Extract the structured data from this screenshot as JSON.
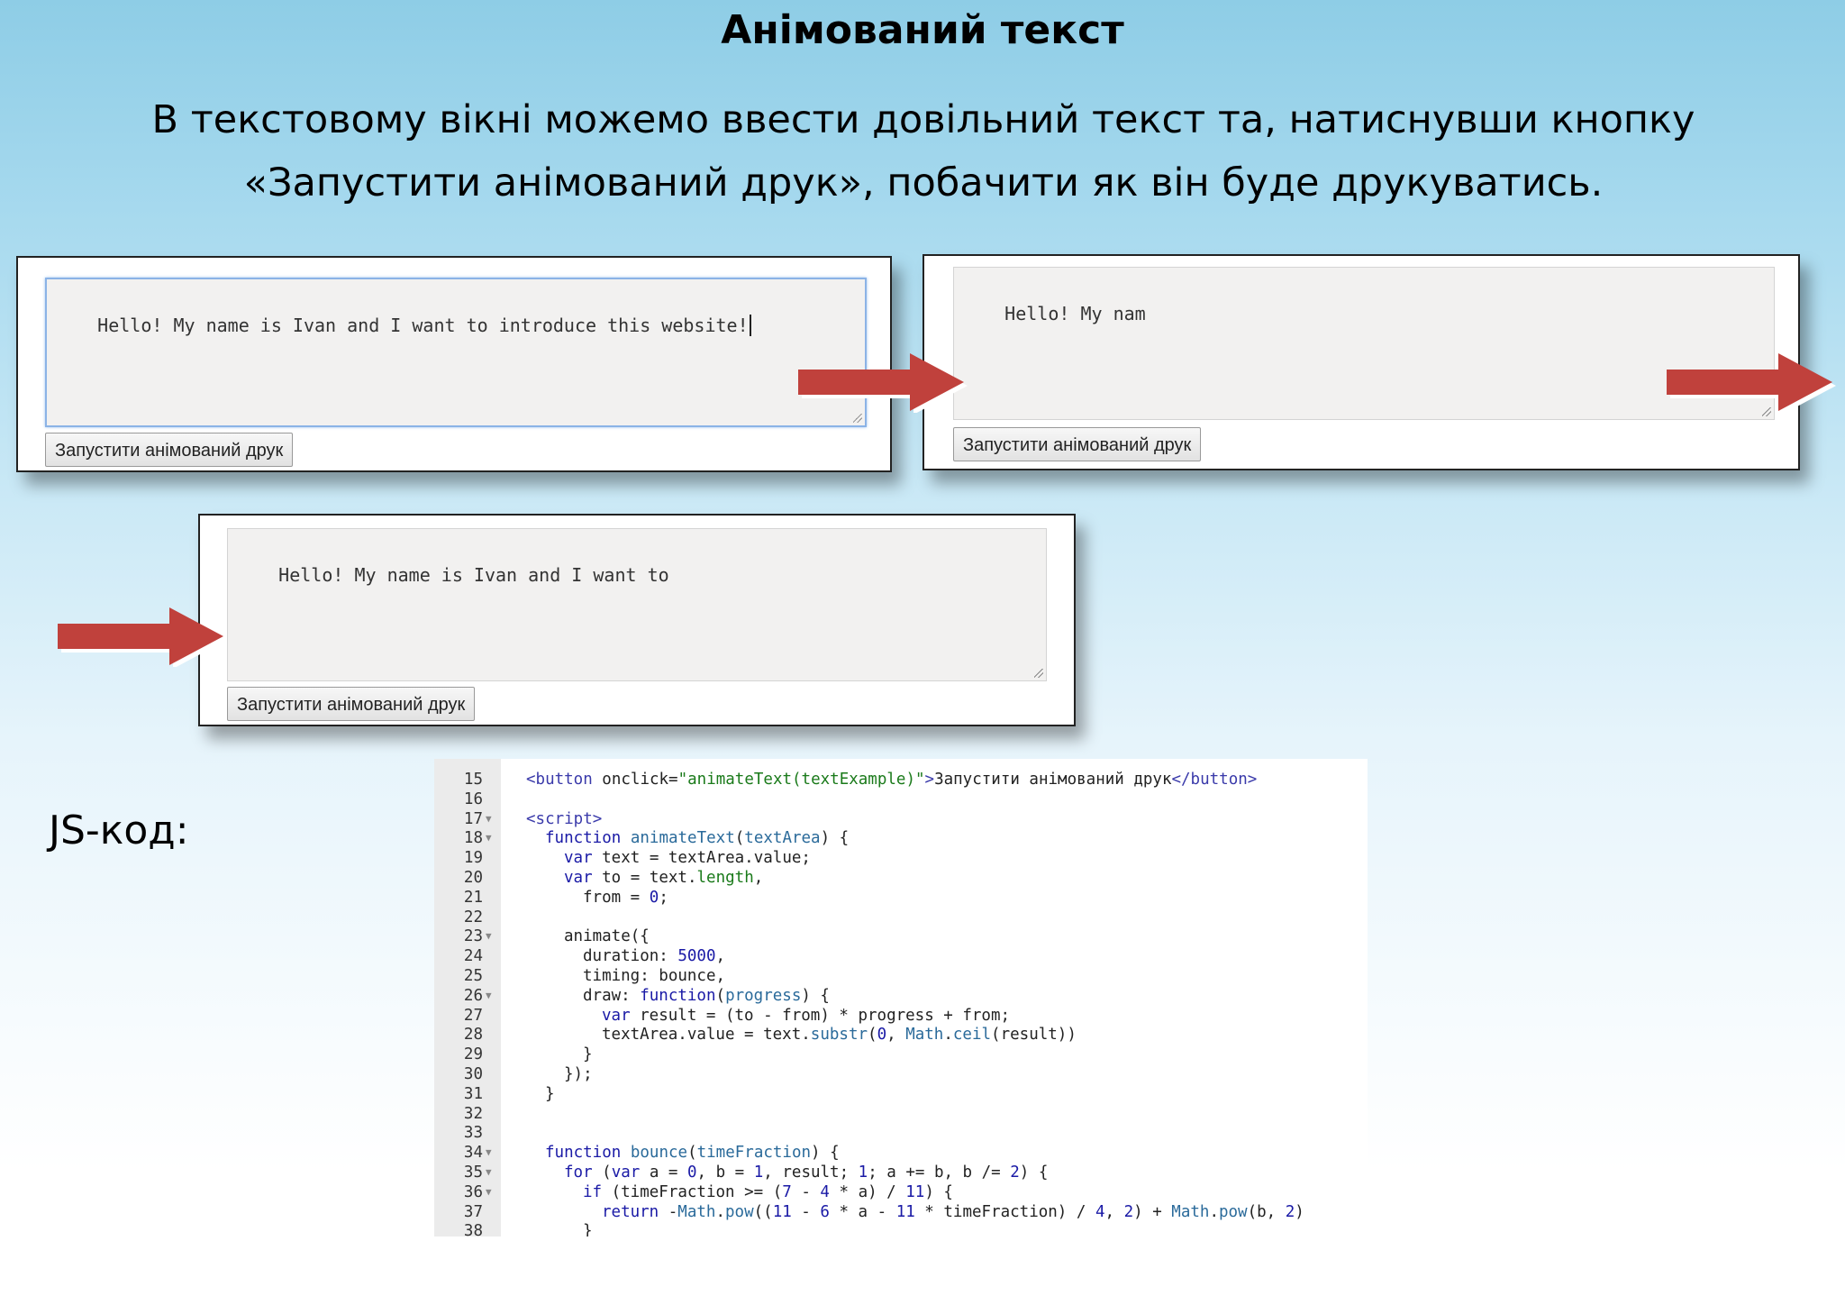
{
  "slide": {
    "title": "Анімований текст",
    "description": "В текстовому вікні можемо ввести довільний текст та, натиснувши кнопку «Запустити анімований друк», побачити як він буде друкуватись."
  },
  "windows": [
    {
      "text": "Hello! My name is Ivan and I want to introduce this website!",
      "button": "Запустити анімований друк"
    },
    {
      "text": "Hello! My nam",
      "button": "Запустити анімований друк"
    },
    {
      "text": "Hello! My name is Ivan and I want to",
      "button": "Запустити анімований друк"
    }
  ],
  "colors": {
    "arrow": "#c0413c",
    "focus": "#8bb3e6"
  },
  "js_label": "JS-код:",
  "code_lines": [
    {
      "n": "15",
      "fold": false,
      "indent": 0,
      "html": "<span class='tag'>&lt;button</span> onclick=<span class='str'>\"animateText(textExample)\"</span><span class='tag'>&gt;</span>Запустити анімований друк<span class='tag'>&lt;/button&gt;</span>"
    },
    {
      "n": "16",
      "fold": false,
      "indent": 0,
      "html": ""
    },
    {
      "n": "17",
      "fold": true,
      "indent": 0,
      "html": "<span class='tag'>&lt;script&gt;</span>"
    },
    {
      "n": "18",
      "fold": true,
      "indent": 1,
      "html": "<span class='kw'>function</span> <span class='var'>animateText</span>(<span class='var'>textArea</span>) {"
    },
    {
      "n": "19",
      "fold": false,
      "indent": 2,
      "html": "<span class='kw'>var</span> text = textArea.value;"
    },
    {
      "n": "20",
      "fold": false,
      "indent": 2,
      "html": "<span class='kw'>var</span> to = text.<span class='str'>length</span>,"
    },
    {
      "n": "21",
      "fold": false,
      "indent": 3,
      "html": "from = <span class='num'>0</span>;"
    },
    {
      "n": "22",
      "fold": false,
      "indent": 0,
      "html": ""
    },
    {
      "n": "23",
      "fold": true,
      "indent": 2,
      "html": "animate({"
    },
    {
      "n": "24",
      "fold": false,
      "indent": 3,
      "html": "duration: <span class='num'>5000</span>,"
    },
    {
      "n": "25",
      "fold": false,
      "indent": 3,
      "html": "timing: bounce,"
    },
    {
      "n": "26",
      "fold": true,
      "indent": 3,
      "html": "draw: <span class='kw'>function</span>(<span class='var'>progress</span>) {"
    },
    {
      "n": "27",
      "fold": false,
      "indent": 4,
      "html": "<span class='kw'>var</span> result = (to - from) * progress + from;"
    },
    {
      "n": "28",
      "fold": false,
      "indent": 4,
      "html": "textArea.value = text.<span class='var'>substr</span>(<span class='num'>0</span>, <span class='var'>Math</span>.<span class='var'>ceil</span>(result))"
    },
    {
      "n": "29",
      "fold": false,
      "indent": 3,
      "html": "}"
    },
    {
      "n": "30",
      "fold": false,
      "indent": 2,
      "html": "});"
    },
    {
      "n": "31",
      "fold": false,
      "indent": 1,
      "html": "}"
    },
    {
      "n": "32",
      "fold": false,
      "indent": 0,
      "html": ""
    },
    {
      "n": "33",
      "fold": false,
      "indent": 0,
      "html": ""
    },
    {
      "n": "34",
      "fold": true,
      "indent": 1,
      "html": "<span class='kw'>function</span> <span class='var'>bounce</span>(<span class='var'>timeFraction</span>) {"
    },
    {
      "n": "35",
      "fold": true,
      "indent": 2,
      "html": "<span class='kw'>for</span> (<span class='kw'>var</span> a = <span class='num'>0</span>, b = <span class='num'>1</span>, result; <span class='num'>1</span>; a += b, b /= <span class='num'>2</span>) {"
    },
    {
      "n": "36",
      "fold": true,
      "indent": 3,
      "html": "<span class='kw'>if</span> (timeFraction &gt;= (<span class='num'>7</span> - <span class='num'>4</span> * a) / <span class='num'>11</span>) {"
    },
    {
      "n": "37",
      "fold": false,
      "indent": 4,
      "html": "<span class='kw'>return</span> -<span class='var'>Math</span>.<span class='var'>pow</span>((<span class='num'>11</span> - <span class='num'>6</span> * a - <span class='num'>11</span> * timeFraction) / <span class='num'>4</span>, <span class='num'>2</span>) + <span class='var'>Math</span>.<span class='var'>pow</span>(b, <span class='num'>2</span>)"
    },
    {
      "n": "38",
      "fold": false,
      "indent": 3,
      "html": "}"
    }
  ]
}
